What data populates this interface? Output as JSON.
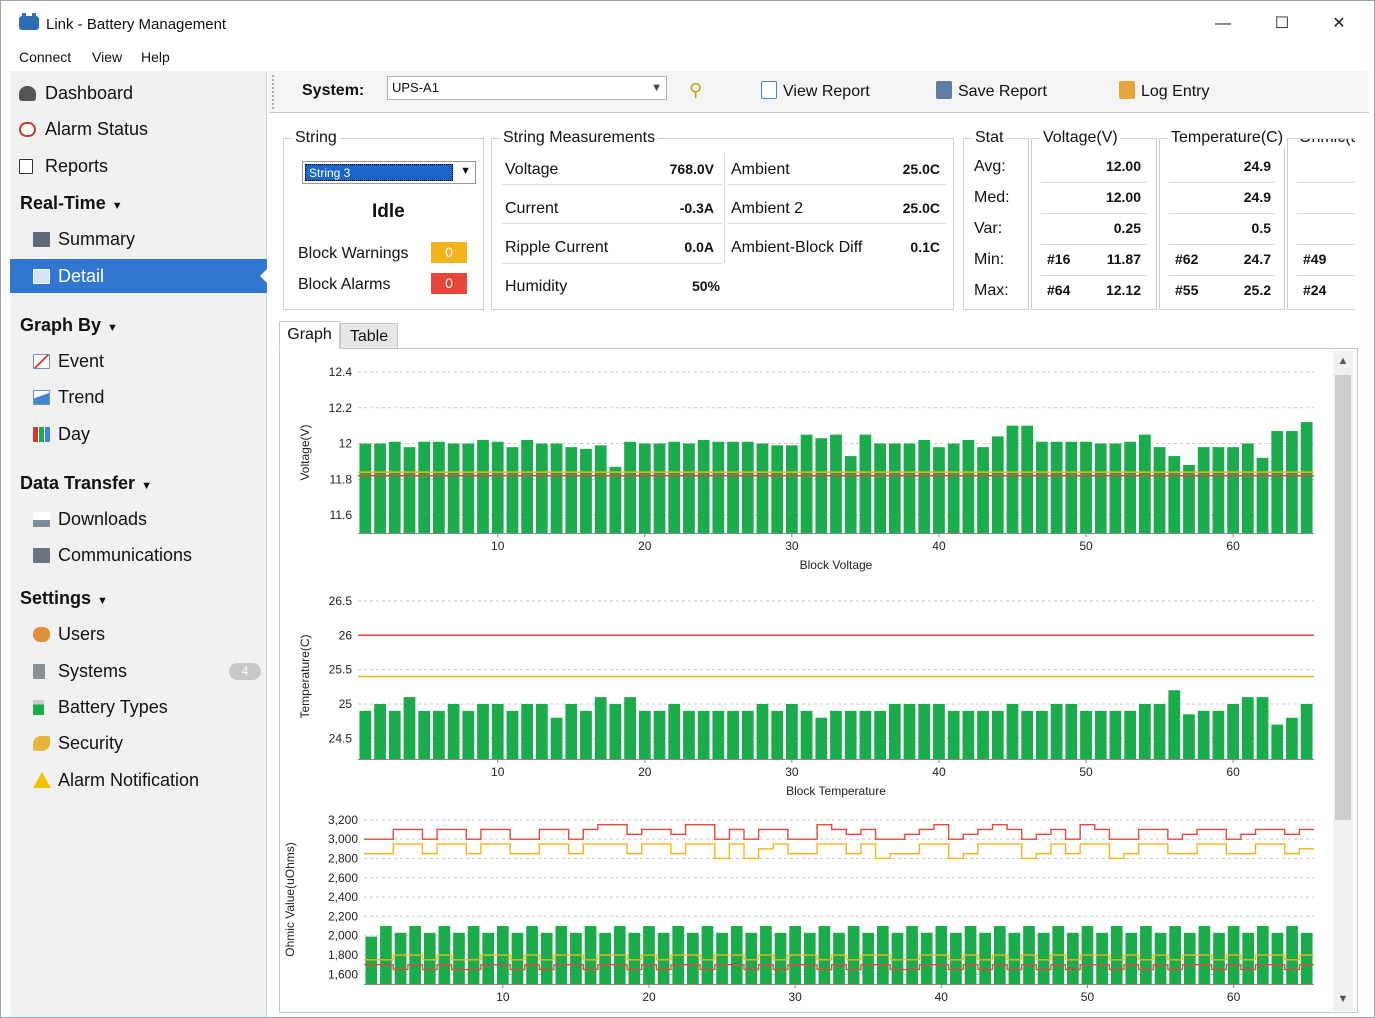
{
  "app": {
    "title": "Link - Battery Management",
    "window_controls": [
      "—",
      "☐",
      "✕"
    ]
  },
  "menu": [
    "Connect",
    "View",
    "Help"
  ],
  "sidebar": {
    "items": [
      {
        "label": "Dashboard",
        "icon": "car-battery-icon",
        "kind": "top"
      },
      {
        "label": "Alarm Status",
        "icon": "alarm-clock-icon",
        "kind": "top"
      },
      {
        "label": "Reports",
        "icon": "document-icon",
        "kind": "top"
      },
      {
        "label": "Real-Time",
        "kind": "section"
      },
      {
        "label": "Summary",
        "icon": "summary-icon",
        "kind": "sub"
      },
      {
        "label": "Detail",
        "icon": "monitor-icon",
        "kind": "sub",
        "active": true
      },
      {
        "label": "Graph By",
        "kind": "section"
      },
      {
        "label": "Event",
        "icon": "line-chart-icon",
        "kind": "sub"
      },
      {
        "label": "Trend",
        "icon": "trend-chart-icon",
        "kind": "sub"
      },
      {
        "label": "Day",
        "icon": "bar-chart-icon",
        "kind": "sub"
      },
      {
        "label": "Data Transfer",
        "kind": "section"
      },
      {
        "label": "Downloads",
        "icon": "download-icon",
        "kind": "sub"
      },
      {
        "label": "Communications",
        "icon": "network-icon",
        "kind": "sub"
      },
      {
        "label": "Settings",
        "kind": "section"
      },
      {
        "label": "Users",
        "icon": "users-icon",
        "kind": "sub"
      },
      {
        "label": "Systems",
        "icon": "server-icon",
        "kind": "sub",
        "badge": "4"
      },
      {
        "label": "Battery Types",
        "icon": "battery-icon",
        "kind": "sub"
      },
      {
        "label": "Security",
        "icon": "key-icon",
        "kind": "sub"
      },
      {
        "label": "Alarm Notification",
        "icon": "warning-icon",
        "kind": "sub"
      }
    ]
  },
  "toolbar": {
    "system_label": "System:",
    "system_value": "UPS-A1",
    "view_report": "View Report",
    "save_report": "Save Report",
    "log_entry": "Log Entry"
  },
  "string_box": {
    "title": "String",
    "selected": "String 3",
    "state": "Idle",
    "block_warnings_label": "Block Warnings",
    "block_warnings": "0",
    "block_alarms_label": "Block Alarms",
    "block_alarms": "0"
  },
  "measurements": {
    "title": "String Measurements",
    "left": [
      {
        "label": "Voltage",
        "value": "768.0V"
      },
      {
        "label": "Current",
        "value": "-0.3A"
      },
      {
        "label": "Ripple Current",
        "value": "0.0A"
      },
      {
        "label": "Humidity",
        "value": "50%"
      }
    ],
    "right": [
      {
        "label": "Ambient",
        "value": "25.0C"
      },
      {
        "label": "Ambient 2",
        "value": "25.0C"
      },
      {
        "label": "Ambient-Block Diff",
        "value": "0.1C"
      }
    ]
  },
  "stats": {
    "col_stat": "Stat",
    "col_voltage": "Voltage(V)",
    "col_temp": "Temperature(C)",
    "col_ohmic": "Ohmic(u",
    "rows": [
      {
        "label": "Avg:",
        "v_id": "",
        "v": "12.00",
        "t_id": "",
        "t": "24.9",
        "o_id": ""
      },
      {
        "label": "Med:",
        "v_id": "",
        "v": "12.00",
        "t_id": "",
        "t": "24.9",
        "o_id": ""
      },
      {
        "label": "Var:",
        "v_id": "",
        "v": "0.25",
        "t_id": "",
        "t": "0.5",
        "o_id": ""
      },
      {
        "label": "Min:",
        "v_id": "#16",
        "v": "11.87",
        "t_id": "#62",
        "t": "24.7",
        "o_id": "#49"
      },
      {
        "label": "Max:",
        "v_id": "#64",
        "v": "12.12",
        "t_id": "#55",
        "t": "25.2",
        "o_id": "#24"
      }
    ]
  },
  "tabs": [
    "Graph",
    "Table"
  ],
  "colors": {
    "bar": "#1aab4a",
    "warn": "#f2b41a",
    "alarm": "#e8463b",
    "accent": "#2f77d0"
  },
  "chart_data": [
    {
      "type": "bar",
      "xlabel": "Block Voltage",
      "ylabel": "Voltage(V)",
      "ylim": [
        11.5,
        12.4
      ],
      "yticks": [
        "12.4",
        "12.2",
        "12",
        "11.8",
        "11.6"
      ],
      "xticks": [
        "10",
        "20",
        "30",
        "40",
        "50",
        "60"
      ],
      "values": [
        12.0,
        12.0,
        12.01,
        11.98,
        12.01,
        12.01,
        12.0,
        12.0,
        12.02,
        12.01,
        11.98,
        12.02,
        12.0,
        12.0,
        11.98,
        11.97,
        11.99,
        11.87,
        12.01,
        12.0,
        12.0,
        12.01,
        12.0,
        12.02,
        12.01,
        12.01,
        12.01,
        12.0,
        11.99,
        11.99,
        12.05,
        12.03,
        12.05,
        11.93,
        12.05,
        12.0,
        12.0,
        12.0,
        12.02,
        11.98,
        12.0,
        12.02,
        11.98,
        12.04,
        12.1,
        12.1,
        12.01,
        12.01,
        12.01,
        12.01,
        12.0,
        12.0,
        12.01,
        12.05,
        11.98,
        11.93,
        11.88,
        11.98,
        11.98,
        11.98,
        12.0,
        11.92,
        12.07,
        12.07,
        12.12
      ],
      "warn_line": 11.84,
      "alarm_line": 11.82,
      "grid": "horizontal-dashed"
    },
    {
      "type": "bar",
      "xlabel": "Block Temperature",
      "ylabel": "Temperature(C)",
      "ylim": [
        24.2,
        26.6
      ],
      "yticks": [
        "26.5",
        "26",
        "25.5",
        "25",
        "24.5"
      ],
      "xticks": [
        "10",
        "20",
        "30",
        "40",
        "50",
        "60"
      ],
      "values": [
        24.9,
        25.0,
        24.9,
        25.1,
        24.9,
        24.9,
        25.0,
        24.9,
        25.0,
        25.0,
        24.9,
        25.0,
        25.0,
        24.8,
        25.0,
        24.9,
        25.1,
        25.0,
        25.1,
        24.9,
        24.9,
        25.0,
        24.9,
        24.9,
        24.9,
        24.9,
        24.9,
        25.0,
        24.9,
        25.0,
        24.9,
        24.8,
        24.9,
        24.9,
        24.9,
        24.9,
        25.0,
        25.0,
        25.0,
        25.0,
        24.9,
        24.9,
        24.9,
        24.9,
        25.0,
        24.9,
        24.9,
        25.0,
        25.0,
        24.9,
        24.9,
        24.9,
        24.9,
        25.0,
        25.0,
        25.2,
        24.85,
        24.9,
        24.9,
        25.0,
        25.1,
        25.1,
        24.7,
        24.8,
        25.0
      ],
      "warn_line": 25.4,
      "alarm_line": 26.0,
      "grid": "horizontal-dashed"
    },
    {
      "type": "bar",
      "xlabel": "",
      "ylabel": "Ohmic Value(uOhms)",
      "ylim": [
        1500,
        3250
      ],
      "yticks": [
        "3,200",
        "3,000",
        "2,800",
        "2,600",
        "2,400",
        "2,200",
        "2,000",
        "1,800",
        "1,600"
      ],
      "xticks": [
        "10",
        "20",
        "30",
        "40",
        "50",
        "60"
      ],
      "values": [
        1990,
        2100,
        2030,
        2100,
        2030,
        2100,
        2030,
        2100,
        2030,
        2100,
        2030,
        2100,
        2030,
        2100,
        2030,
        2100,
        2030,
        2100,
        2030,
        2100,
        2030,
        2100,
        2030,
        2100,
        2030,
        2100,
        2030,
        2100,
        2030,
        2100,
        2030,
        2100,
        2030,
        2100,
        2030,
        2100,
        2030,
        2100,
        2030,
        2100,
        2030,
        2100,
        2030,
        2100,
        2030,
        2100,
        2030,
        2100,
        2030,
        2100,
        2030,
        2100,
        2030,
        2100,
        2030,
        2100,
        2030,
        2100,
        2030,
        2100,
        2030,
        2100,
        2030,
        2100,
        2030
      ],
      "alarm_step": [
        3000,
        3000,
        3100,
        3100,
        3000,
        3100,
        3100,
        3000,
        3100,
        3100,
        3000,
        3000,
        3100,
        3100,
        3000,
        3100,
        3150,
        3150,
        3050,
        3100,
        3100,
        3050,
        3150,
        3150,
        3000,
        3100,
        3000,
        3100,
        3100,
        3000,
        3000,
        3150,
        3100,
        3050,
        3100,
        3000,
        3000,
        3050,
        3100,
        3150,
        3000,
        3050,
        3100,
        3150,
        3100,
        3000,
        3050,
        3100,
        3000,
        3150,
        3100,
        3000,
        3000,
        3100,
        3100,
        3000,
        3050,
        3100,
        3100,
        3000,
        3050,
        3100,
        3100,
        3050,
        3100
      ],
      "warn_step": [
        2850,
        2850,
        2950,
        2950,
        2850,
        2950,
        2950,
        2850,
        2950,
        2950,
        2850,
        2850,
        2950,
        2950,
        2850,
        2950,
        2950,
        2950,
        2850,
        2950,
        2950,
        2850,
        2950,
        2950,
        2800,
        2950,
        2800,
        2900,
        2950,
        2850,
        2850,
        2950,
        2950,
        2850,
        2950,
        2800,
        2850,
        2850,
        2950,
        2950,
        2800,
        2850,
        2950,
        2950,
        2950,
        2800,
        2850,
        2950,
        2850,
        2950,
        2950,
        2800,
        2850,
        2950,
        2950,
        2850,
        2850,
        2950,
        2950,
        2850,
        2850,
        2950,
        2950,
        2850,
        2900
      ],
      "low_alarm_step": [
        1700,
        1700,
        1650,
        1700,
        1650,
        1700,
        1650,
        1650,
        1700,
        1700,
        1650,
        1700,
        1650,
        1700,
        1700,
        1650,
        1700,
        1700,
        1650,
        1700,
        1650,
        1700,
        1700,
        1650,
        1700,
        1700,
        1650,
        1700,
        1650,
        1700,
        1700,
        1650,
        1700,
        1650,
        1700,
        1700,
        1650,
        1650,
        1700,
        1700,
        1650,
        1700,
        1650,
        1700,
        1650,
        1700,
        1650,
        1700,
        1650,
        1700,
        1700,
        1650,
        1700,
        1650,
        1700,
        1650,
        1700,
        1700,
        1650,
        1700,
        1650,
        1700,
        1700,
        1650,
        1700
      ],
      "low_warn_step": [
        1750,
        1750,
        1800,
        1800,
        1750,
        1800,
        1750,
        1750,
        1800,
        1800,
        1750,
        1800,
        1750,
        1800,
        1800,
        1750,
        1800,
        1800,
        1750,
        1800,
        1750,
        1800,
        1800,
        1750,
        1800,
        1800,
        1750,
        1800,
        1750,
        1800,
        1800,
        1750,
        1800,
        1750,
        1800,
        1800,
        1750,
        1750,
        1800,
        1800,
        1750,
        1800,
        1750,
        1800,
        1750,
        1800,
        1750,
        1800,
        1750,
        1800,
        1800,
        1750,
        1800,
        1750,
        1800,
        1750,
        1800,
        1800,
        1750,
        1800,
        1750,
        1800,
        1800,
        1750,
        1800
      ],
      "grid": "horizontal-dashed"
    }
  ]
}
